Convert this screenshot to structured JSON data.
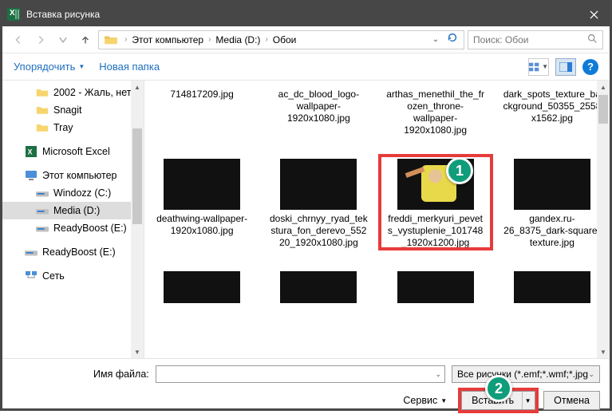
{
  "titlebar": {
    "title": "Вставка рисунка"
  },
  "breadcrumb": {
    "parts": [
      "Этот компьютер",
      "Media (D:)",
      "Обои"
    ]
  },
  "search": {
    "placeholder": "Поиск: Обои"
  },
  "toolbar": {
    "organize": "Упорядочить",
    "newfolder": "Новая папка"
  },
  "tree": {
    "items": [
      {
        "label": "2002 - Жаль, нет",
        "kind": "folder",
        "indent": true
      },
      {
        "label": "Snagit",
        "kind": "folder",
        "indent": true
      },
      {
        "label": "Tray",
        "kind": "folder",
        "indent": true
      }
    ],
    "excel": "Microsoft Excel",
    "pc": "Этот компьютер",
    "drives": [
      {
        "label": "Windozz (C:)"
      },
      {
        "label": "Media (D:)",
        "selected": true
      },
      {
        "label": "ReadyBoost (E:)"
      }
    ],
    "readyboost": "ReadyBoost (E:)",
    "network": "Сеть"
  },
  "grid": {
    "row1": [
      "714817209.jpg",
      "ac_dc_blood_logo-wallpaper-1920x1080.jpg",
      "arthas_menethil_the_frozen_throne-wallpaper-1920x1080.jpg",
      "dark_spots_texture_background_50355_2558x1562.jpg"
    ],
    "row2": [
      {
        "label": "deathwing-wallpaper-1920x1080.jpg",
        "thumb": "th-deathwing"
      },
      {
        "label": "doski_chrnyy_ryad_tekstura_fon_derevo_55220_1920x1080.jpg",
        "thumb": "th-doski"
      },
      {
        "label": "freddi_merkyuri_pevets_vystuplenie_101748_1920x1200.jpg",
        "thumb": "th-freddi",
        "highlight": true
      },
      {
        "label": "gandex.ru-26_8375_dark-square-texture.jpg",
        "thumb": "th-gandex"
      }
    ],
    "row3": [
      "th-bottom1",
      "th-bottom2",
      "th-bottom3",
      "th-bottom4"
    ]
  },
  "footer": {
    "filename_label": "Имя файла:",
    "filename_value": "",
    "filter": "Все рисунки (*.emf;*.wmf;*.jpg",
    "service": "Сервис",
    "insert": "Вставить",
    "cancel": "Отмена"
  },
  "annotations": {
    "one": "1",
    "two": "2"
  }
}
